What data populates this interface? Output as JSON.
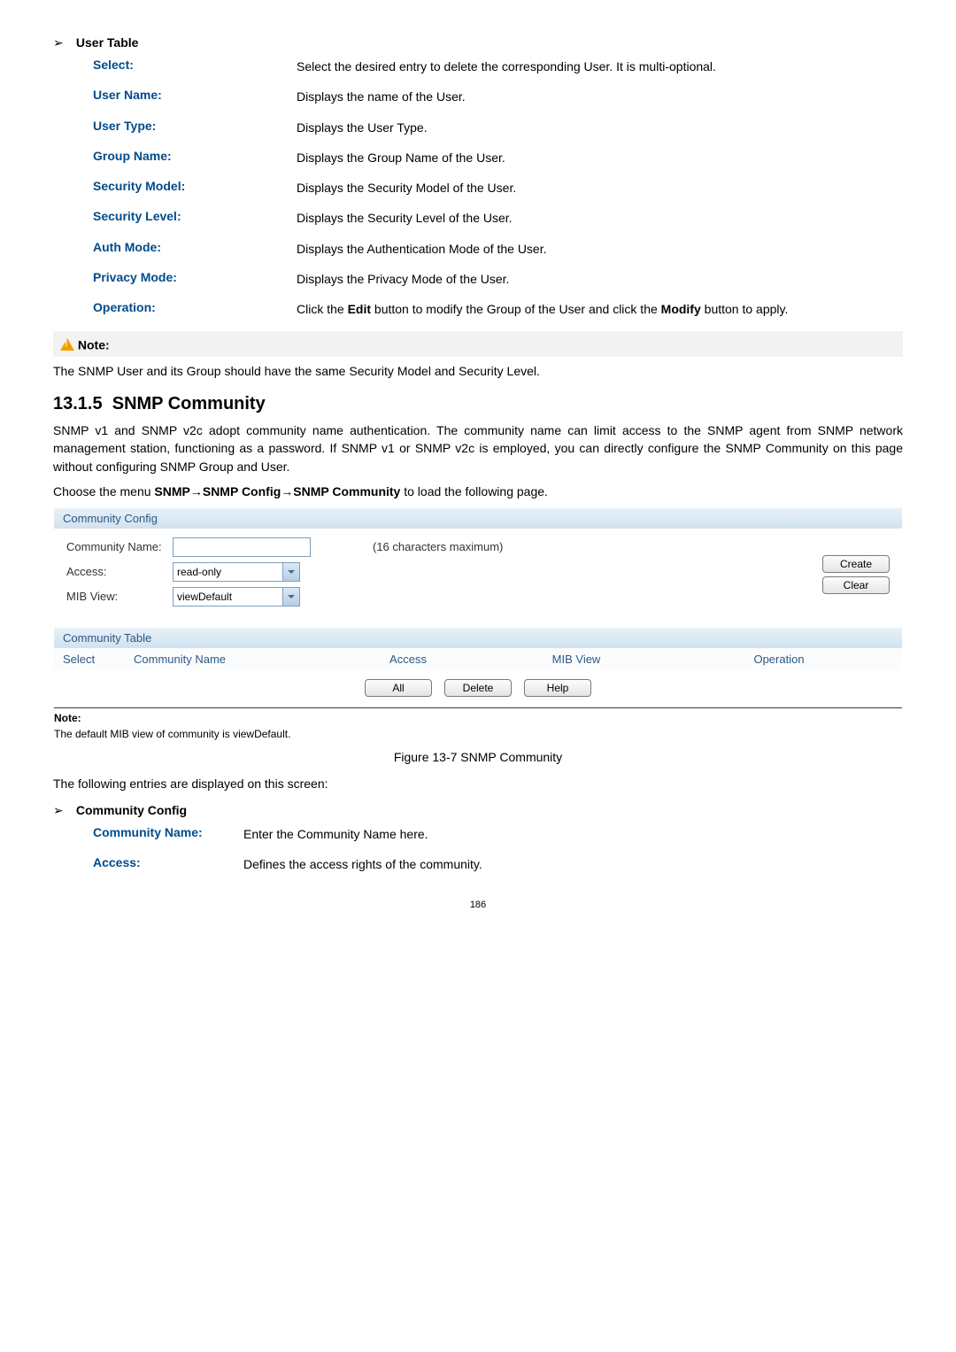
{
  "userTable": {
    "heading": "User Table",
    "rows": [
      {
        "term": "Select:",
        "desc": "Select the desired entry to delete the corresponding User. It is multi-optional."
      },
      {
        "term": "User Name:",
        "desc": "Displays the name of the User."
      },
      {
        "term": "User Type:",
        "desc": "Displays the User Type."
      },
      {
        "term": "Group Name:",
        "desc": "Displays the Group Name of the User."
      },
      {
        "term": "Security Model:",
        "desc": "Displays the Security Model of the User."
      },
      {
        "term": "Security Level:",
        "desc": "Displays the Security Level of the User."
      },
      {
        "term": "Auth Mode:",
        "desc": "Displays the Authentication Mode of the User."
      },
      {
        "term": "Privacy Mode:",
        "desc": "Displays the Privacy Mode of the User."
      }
    ],
    "operation": {
      "term": "Operation:",
      "pre": "Click the ",
      "bold1": "Edit",
      "mid": " button to modify the Group of the User and click the ",
      "bold2": "Modify",
      "post": " button to apply."
    }
  },
  "noteBox": {
    "label": "Note:",
    "text": "The SNMP User and its Group should have the same Security Model and Security Level."
  },
  "heading": {
    "number": "13.1.5",
    "title": "SNMP Community"
  },
  "bodyPara": "SNMP v1 and SNMP v2c adopt community name authentication. The community name can limit access to the SNMP agent from SNMP network management station, functioning as a password. If SNMP v1 or SNMP v2c is employed, you can directly configure the SNMP Community on this page without configuring SNMP Group and User.",
  "menuPath": {
    "pre": "Choose the menu ",
    "bold": "SNMP→SNMP Config→SNMP Community",
    "post": " to load the following page."
  },
  "communityConfig": {
    "title": "Community Config",
    "nameLabel": "Community Name:",
    "hint": "(16 characters maximum)",
    "accessLabel": "Access:",
    "accessValue": "read-only",
    "mibLabel": "MIB View:",
    "mibValue": "viewDefault",
    "createBtn": "Create",
    "clearBtn": "Clear"
  },
  "communityTable": {
    "title": "Community Table",
    "columns": {
      "select": "Select",
      "name": "Community Name",
      "access": "Access",
      "mib": "MIB View",
      "op": "Operation"
    },
    "actions": {
      "all": "All",
      "delete": "Delete",
      "help": "Help"
    }
  },
  "panelNote": {
    "label": "Note:",
    "text": "The default MIB view of community is viewDefault."
  },
  "figureCaption": "Figure 13-7 SNMP Community",
  "followingText": "The following entries are displayed on this screen:",
  "communityConfigDefs": {
    "heading": "Community Config",
    "rows": [
      {
        "term": "Community Name:",
        "desc": "Enter the Community Name here."
      },
      {
        "term": "Access:",
        "desc": "Defines the access rights of the community."
      }
    ]
  },
  "pageNumber": "186"
}
